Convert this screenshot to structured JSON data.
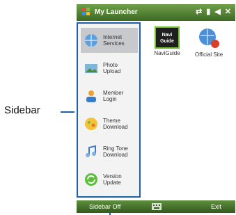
{
  "callout": {
    "label": "Sidebar"
  },
  "titlebar": {
    "title": "My Launcher",
    "status_icons": [
      "sync-icon",
      "signal-icon",
      "volume-icon",
      "close-icon"
    ]
  },
  "sidebar": {
    "items": [
      {
        "label": "Internet Services",
        "icon": "globe-icon",
        "selected": true
      },
      {
        "label": "Photo Upload",
        "icon": "photo-icon",
        "selected": false
      },
      {
        "label": "Member Login",
        "icon": "user-icon",
        "selected": false
      },
      {
        "label": "Theme Download",
        "icon": "theme-icon",
        "selected": false
      },
      {
        "label": "Ring Tone Download",
        "icon": "music-icon",
        "selected": false
      },
      {
        "label": "Version Update",
        "icon": "update-icon",
        "selected": false
      }
    ]
  },
  "content": {
    "apps": [
      {
        "label": "NaviGuide",
        "icon_text": "Navi Guide",
        "icon": "naviguide-icon"
      },
      {
        "label": "Official Site",
        "icon": "official-site-icon"
      }
    ]
  },
  "softkeys": {
    "left": "Sidebar Off",
    "right": "Exit",
    "middle_icon": "keyboard-icon"
  },
  "colors": {
    "titlebar": "#4a7a2e",
    "sidebar_border": "#1f5fa8",
    "selected_row": "#c7c9cc"
  }
}
